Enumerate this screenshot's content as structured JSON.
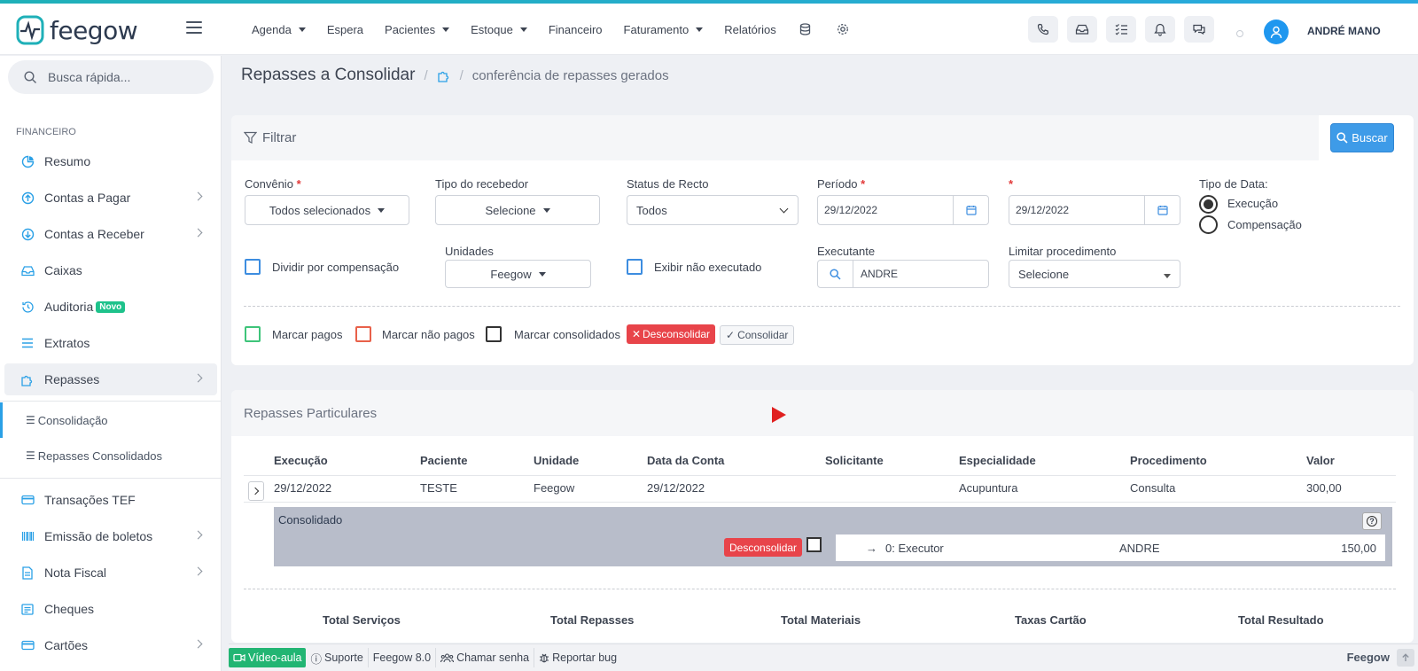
{
  "app": {
    "name": "feegow",
    "user": "ANDRÉ MANO"
  },
  "topnav": [
    {
      "label": "Agenda",
      "caret": true
    },
    {
      "label": "Espera",
      "caret": false
    },
    {
      "label": "Pacientes",
      "caret": true
    },
    {
      "label": "Estoque",
      "caret": true
    },
    {
      "label": "Financeiro",
      "caret": false
    },
    {
      "label": "Faturamento",
      "caret": true
    },
    {
      "label": "Relatórios",
      "caret": false
    }
  ],
  "search": {
    "placeholder": "Busca rápida..."
  },
  "sidebar": {
    "section": "FINANCEIRO",
    "items": [
      {
        "label": "Resumo",
        "icon": "chart-pie-icon"
      },
      {
        "label": "Contas a Pagar",
        "icon": "arrow-up-circle-icon"
      },
      {
        "label": "Contas a Receber",
        "icon": "arrow-down-circle-icon"
      },
      {
        "label": "Caixas",
        "icon": "inbox-icon"
      },
      {
        "label": "Auditoria",
        "icon": "history-icon",
        "badge": "Novo"
      },
      {
        "label": "Extratos",
        "icon": "list-icon"
      },
      {
        "label": "Repasses",
        "icon": "puzzle-icon"
      }
    ],
    "subitems": [
      {
        "label": "Consolidação"
      },
      {
        "label": "Repasses Consolidados"
      }
    ],
    "items2": [
      {
        "label": "Transações TEF",
        "icon": "credit-card-icon"
      },
      {
        "label": "Emissão de boletos",
        "icon": "barcode-icon"
      },
      {
        "label": "Nota Fiscal",
        "icon": "file-icon"
      },
      {
        "label": "Cheques",
        "icon": "cheque-icon"
      },
      {
        "label": "Cartões",
        "icon": "card-icon"
      }
    ]
  },
  "breadcrumb": {
    "title": "Repasses a Consolidar",
    "sub": "conferência de repasses gerados"
  },
  "filter": {
    "header": "Filtrar",
    "buscar": "Buscar",
    "convenio_label": "Convênio",
    "convenio_value": "Todos selecionados",
    "tipo_recebedor_label": "Tipo do recebedor",
    "tipo_recebedor_value": "Selecione",
    "status_label": "Status de Recto",
    "status_value": "Todos",
    "periodo_label": "Período",
    "periodo_from": "29/12/2022",
    "periodo_to": "29/12/2022",
    "tipo_data_label": "Tipo de Data:",
    "tipo_data_options": [
      "Execução",
      "Compensação"
    ],
    "dividir_label": "Dividir por compensação",
    "unidades_label": "Unidades",
    "unidades_value": "Feegow",
    "exibir_label": "Exibir não executado",
    "executante_label": "Executante",
    "executante_value": "ANDRE",
    "limitar_label": "Limitar procedimento",
    "limitar_value": "Selecione",
    "marcar_pagos": "Marcar pagos",
    "marcar_nao_pagos": "Marcar não pagos",
    "marcar_consolidados": "Marcar consolidados",
    "desconsolidar": "Desconsolidar",
    "consolidar": "Consolidar"
  },
  "results": {
    "header": "Repasses Particulares",
    "columns": [
      "Execução",
      "Paciente",
      "Unidade",
      "Data da Conta",
      "Solicitante",
      "Especialidade",
      "Procedimento",
      "Valor"
    ],
    "row": [
      "29/12/2022",
      "TESTE",
      "Feegow",
      "29/12/2022",
      "",
      "Acupuntura",
      "Consulta",
      "300,00"
    ],
    "consolidado": {
      "title": "Consolidado",
      "desconsolidar": "Desconsolidar",
      "role": "0: Executor",
      "person": "ANDRE",
      "value": "150,00"
    },
    "totals": [
      "Total Serviços",
      "Total Repasses",
      "Total Materiais",
      "Taxas Cartão",
      "Total Resultado"
    ]
  },
  "footer": {
    "video": "Vídeo-aula",
    "suporte": "Suporte",
    "version": "Feegow 8.0",
    "chamar": "Chamar senha",
    "bug": "Reportar bug",
    "brand": "Feegow"
  },
  "colors": {
    "accent": "#3e9be8",
    "danger": "#e8444a",
    "success": "#22b573",
    "consolidado_bg": "#b8bdca"
  }
}
